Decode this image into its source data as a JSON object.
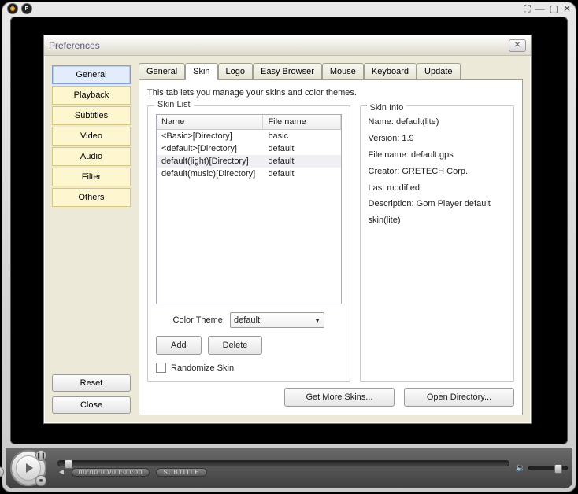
{
  "titlebar": {
    "logo2": "P"
  },
  "dialog": {
    "title": "Preferences",
    "nav": [
      "General",
      "Playback",
      "Subtitles",
      "Video",
      "Audio",
      "Filter",
      "Others"
    ],
    "nav_selected": 0,
    "reset": "Reset",
    "close": "Close"
  },
  "tabs": {
    "items": [
      "General",
      "Skin",
      "Logo",
      "Easy Browser",
      "Mouse",
      "Keyboard",
      "Update"
    ],
    "active": 1,
    "desc": "This tab lets you manage your skins and color themes."
  },
  "skin_list": {
    "legend": "Skin List",
    "col_name": "Name",
    "col_file": "File name",
    "rows": [
      {
        "name": "<Basic>[Directory]",
        "file": "basic"
      },
      {
        "name": "<default>[Directory]",
        "file": "default"
      },
      {
        "name": "default(light)[Directory]",
        "file": "default"
      },
      {
        "name": "default(music)[Directory]",
        "file": "default"
      }
    ],
    "selected": 2,
    "theme_label": "Color Theme:",
    "theme_value": "default",
    "add": "Add",
    "delete": "Delete",
    "randomize": "Randomize Skin"
  },
  "skin_info": {
    "legend": "Skin Info",
    "name_label": "Name: ",
    "name": "default(lite)",
    "version_label": "Version: ",
    "version": "1.9",
    "file_label": "File name: ",
    "file": "default.gps",
    "creator_label": "Creator: ",
    "creator": "GRETECH Corp.",
    "modified_label": "Last modified:",
    "modified": "",
    "desc_label": "Description: ",
    "desc": "Gom Player default skin(lite)"
  },
  "footer": {
    "get_more": "Get More Skins...",
    "open_dir": "Open Directory..."
  },
  "player": {
    "timecode": "00:00:00/00:00:00",
    "subtitle": "SUBTITLE"
  }
}
